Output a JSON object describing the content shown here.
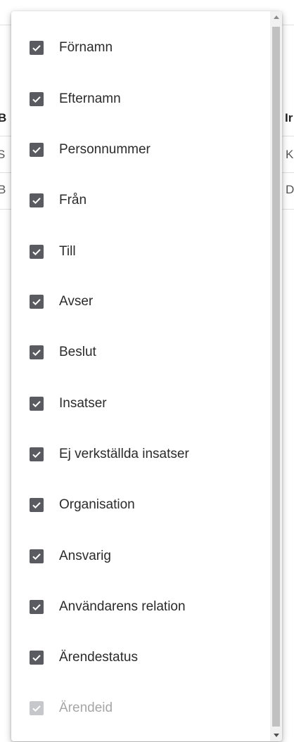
{
  "background_table": {
    "left_chars": [
      "B",
      "S",
      "B"
    ],
    "right_chars": [
      "Ir",
      "K",
      "D"
    ]
  },
  "menu": {
    "items": [
      {
        "label": "Förnamn",
        "checked": true,
        "disabled": false
      },
      {
        "label": "Efternamn",
        "checked": true,
        "disabled": false
      },
      {
        "label": "Personnummer",
        "checked": true,
        "disabled": false
      },
      {
        "label": "Från",
        "checked": true,
        "disabled": false
      },
      {
        "label": "Till",
        "checked": true,
        "disabled": false
      },
      {
        "label": "Avser",
        "checked": true,
        "disabled": false
      },
      {
        "label": "Beslut",
        "checked": true,
        "disabled": false
      },
      {
        "label": "Insatser",
        "checked": true,
        "disabled": false
      },
      {
        "label": "Ej verkställda insatser",
        "checked": true,
        "disabled": false
      },
      {
        "label": "Organisation",
        "checked": true,
        "disabled": false
      },
      {
        "label": "Ansvarig",
        "checked": true,
        "disabled": false
      },
      {
        "label": "Användarens relation",
        "checked": true,
        "disabled": false
      },
      {
        "label": "Ärendestatus",
        "checked": true,
        "disabled": false
      },
      {
        "label": "Ärendeid",
        "checked": true,
        "disabled": true
      }
    ]
  },
  "icons": {
    "checkbox": "check-icon",
    "scroll_up": "arrow-up-icon",
    "scroll_down": "arrow-down-icon"
  },
  "colors": {
    "checkbox_checked": "#595b60",
    "checkbox_disabled": "#c5c7ca",
    "label_text": "#2b2b2b",
    "label_disabled": "#a6a6a6"
  }
}
